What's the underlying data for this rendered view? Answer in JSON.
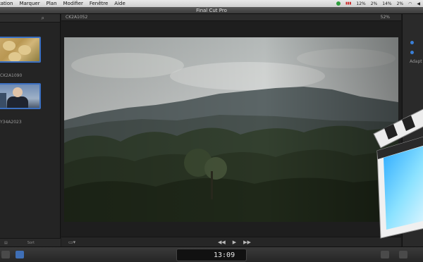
{
  "menubar": {
    "items": [
      "tation",
      "Marquer",
      "Plan",
      "Modifier",
      "Fenêtre",
      "Aide"
    ],
    "status": [
      "12%",
      "2%",
      "14%",
      "2%"
    ]
  },
  "app": {
    "title": "Final Cut Pro"
  },
  "browser": {
    "clips": [
      {
        "label": "CK2A1090"
      },
      {
        "label": "Y34A2023"
      }
    ],
    "sort_label": "Sort"
  },
  "viewer": {
    "clip_name": "CK2A1052",
    "zoom": "52%"
  },
  "inspector": {
    "label": "Adapt"
  },
  "toolbar": {
    "timecode": "13:09"
  },
  "colors": {
    "selection": "#3b6fc0",
    "accent_blue": "#3a7fd6"
  }
}
